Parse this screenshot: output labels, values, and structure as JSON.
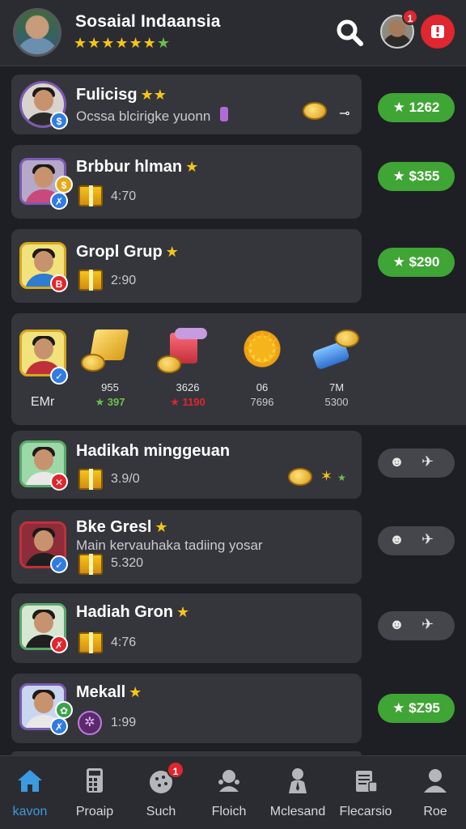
{
  "header": {
    "title": "Sosaial Indaansia",
    "stars": "★★★★★★",
    "half_star": "★",
    "alert_icon": "exclamation-icon",
    "profile_badge": "1"
  },
  "list": [
    {
      "name": "Fulicisg",
      "stars": "★★",
      "sub": "Ocssa blcirigke yuonn",
      "badge": "$",
      "pill": "★ 1262"
    },
    {
      "name": "Brbbur hlman",
      "stars": "★",
      "value": "4:70",
      "badge": "✗",
      "pill": "★ $355"
    },
    {
      "name": "Gropl Grup",
      "stars": "★",
      "value": "2:90",
      "badge": "B",
      "pill": "★ $290"
    },
    {
      "name": "Hadikah minggeuan",
      "stars": "",
      "value": "3.9/0",
      "badge": "✕"
    },
    {
      "name": "Bke Gresl",
      "stars": "★",
      "sub": "Main kervauhaka tadiing yosar",
      "value": "5.320",
      "badge": "✓"
    },
    {
      "name": "Hadiah Gron",
      "stars": "★",
      "value": "4:76",
      "badge": "✗"
    },
    {
      "name": "Mekall",
      "stars": "★",
      "value": "1:99",
      "badge": "✗",
      "pill": "★ $Z95"
    }
  ],
  "rewards": {
    "user_label": "EMr",
    "items": [
      {
        "top": "955",
        "bottom": "★ 397",
        "color": "#6cc04a"
      },
      {
        "top": "3626",
        "bottom": "★ 1190",
        "color": "#e0262e"
      },
      {
        "top": "06",
        "bottom": "7696",
        "color": "#c9cacf"
      },
      {
        "top": "7M",
        "bottom": "5300",
        "color": "#c9cacf"
      }
    ]
  },
  "nav": [
    {
      "label": "kavon",
      "icon": "home-icon",
      "active": true
    },
    {
      "label": "Proaip",
      "icon": "calculator-icon"
    },
    {
      "label": "Such",
      "icon": "cookie-icon",
      "badge": "1"
    },
    {
      "label": "Floich",
      "icon": "chat-icon"
    },
    {
      "label": "Mclesand",
      "icon": "person-icon"
    },
    {
      "label": "Flecarsio",
      "icon": "document-icon"
    },
    {
      "label": "Roe",
      "icon": "profile-icon"
    }
  ],
  "colors": {
    "accent_green": "#3fa535",
    "accent_blue": "#3a9be0",
    "alert_red": "#e0262e",
    "gold": "#f5c518"
  }
}
